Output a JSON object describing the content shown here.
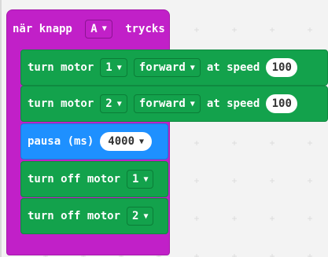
{
  "event": {
    "prefix": "när knapp",
    "button": "A",
    "suffix": "trycks"
  },
  "blocks": [
    {
      "type": "motor_speed",
      "label": "turn motor",
      "motor": "1",
      "direction": "forward",
      "speed_label": "at speed",
      "speed": "100"
    },
    {
      "type": "motor_speed",
      "label": "turn motor",
      "motor": "2",
      "direction": "forward",
      "speed_label": "at speed",
      "speed": "100"
    },
    {
      "type": "pause",
      "label": "pausa (ms)",
      "value": "4000"
    },
    {
      "type": "motor_off",
      "label": "turn off motor",
      "motor": "1"
    },
    {
      "type": "motor_off",
      "label": "turn off motor",
      "motor": "2"
    }
  ],
  "icons": {
    "dropdown": "chevron-down-icon"
  },
  "colors": {
    "event": "#c120c8",
    "motor": "#13a24c",
    "pause": "#1e90ff",
    "workspace": "#f3f3f3"
  }
}
